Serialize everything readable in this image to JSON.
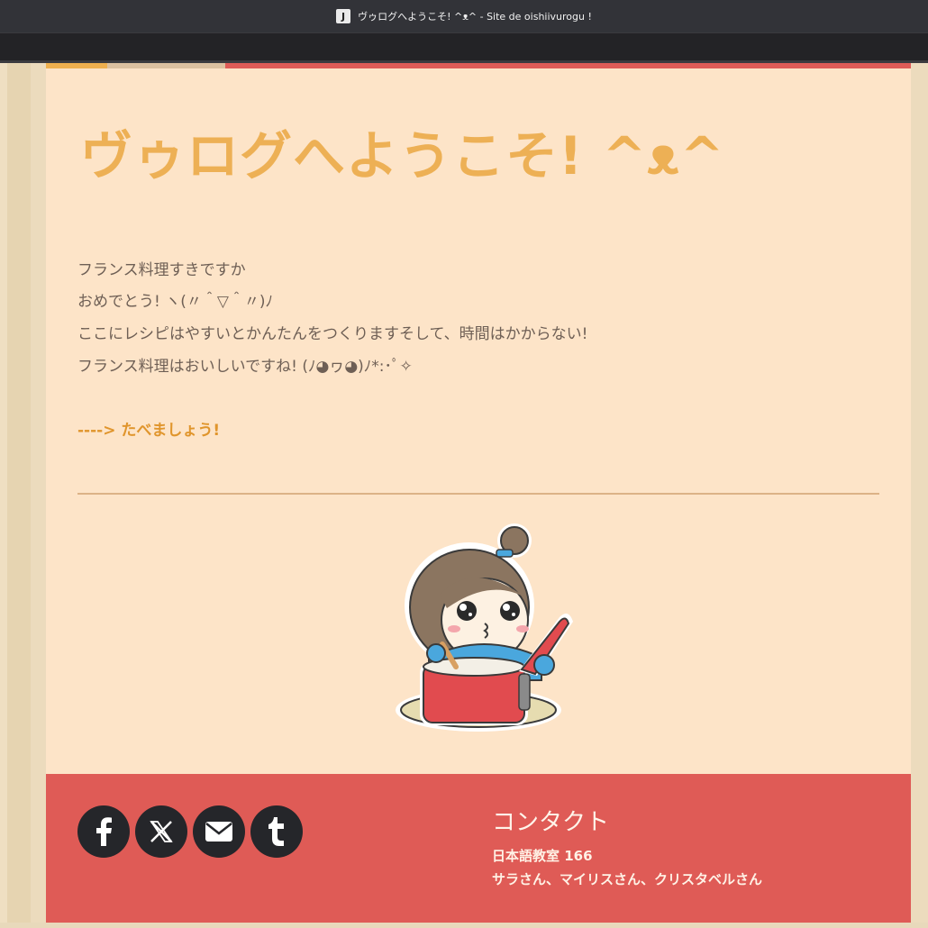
{
  "window": {
    "icon_letter": "J",
    "title": "ヴゥログへようこそ! ^ᴥ^ - Site de oishiivurogu !"
  },
  "main": {
    "title": "ヴゥログへようこそ! ^ᴥ^",
    "paragraphs": [
      "フランス料理すきですか",
      "おめでとう! ヽ(〃＾▽＾〃)ﾉ",
      "ここにレシピはやすいとかんたんをつくりますそして、時間はかからない!",
      "フランス料理はおいしいですね! (ﾉ◕ヮ◕)ﾉ*:･ﾟ✧"
    ],
    "cta_link": "----> たべましょう!",
    "illustration": "girl-cooking-pot-icon"
  },
  "footer": {
    "social": [
      {
        "name": "facebook",
        "icon": "facebook-icon"
      },
      {
        "name": "x",
        "icon": "x-icon"
      },
      {
        "name": "email",
        "icon": "mail-icon"
      },
      {
        "name": "tumblr",
        "icon": "tumblr-icon"
      }
    ],
    "contact_heading": "コンタクト",
    "contact_line1": "日本語教室  166",
    "contact_line2": "サラさん、マイリスさん、クリスタベルさん"
  },
  "colors": {
    "title_orange": "#edb055",
    "link_orange": "#e0952c",
    "footer_red": "#df5b56",
    "card_bg": "#fde4c8"
  }
}
